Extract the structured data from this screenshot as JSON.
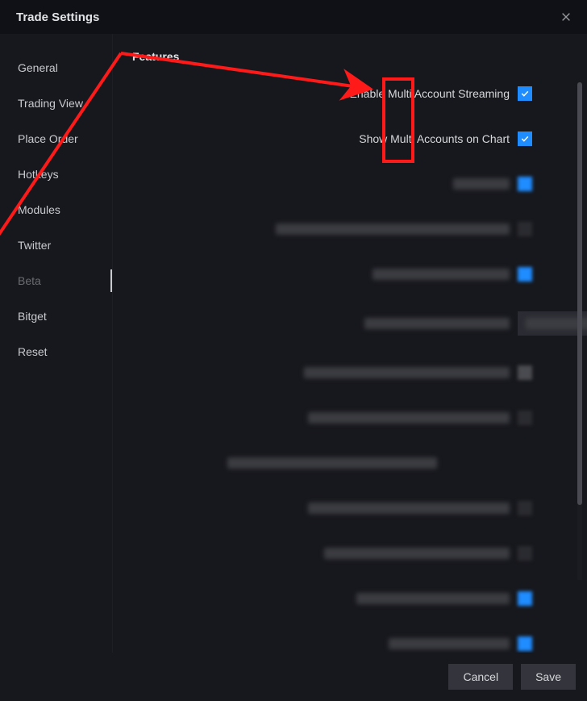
{
  "title": "Trade Settings",
  "sidebar": {
    "items": [
      {
        "label": "General"
      },
      {
        "label": "Trading View"
      },
      {
        "label": "Place Order"
      },
      {
        "label": "Hotkeys"
      },
      {
        "label": "Modules"
      },
      {
        "label": "Twitter"
      },
      {
        "label": "Beta",
        "active": true
      },
      {
        "label": "Bitget"
      },
      {
        "label": "Reset"
      }
    ]
  },
  "section": {
    "title": "Features",
    "option_streaming": "Enable Multi Account Streaming",
    "option_show_on_chart": "Show Multi Accounts on Chart"
  },
  "footer": {
    "cancel": "Cancel",
    "save": "Save"
  }
}
